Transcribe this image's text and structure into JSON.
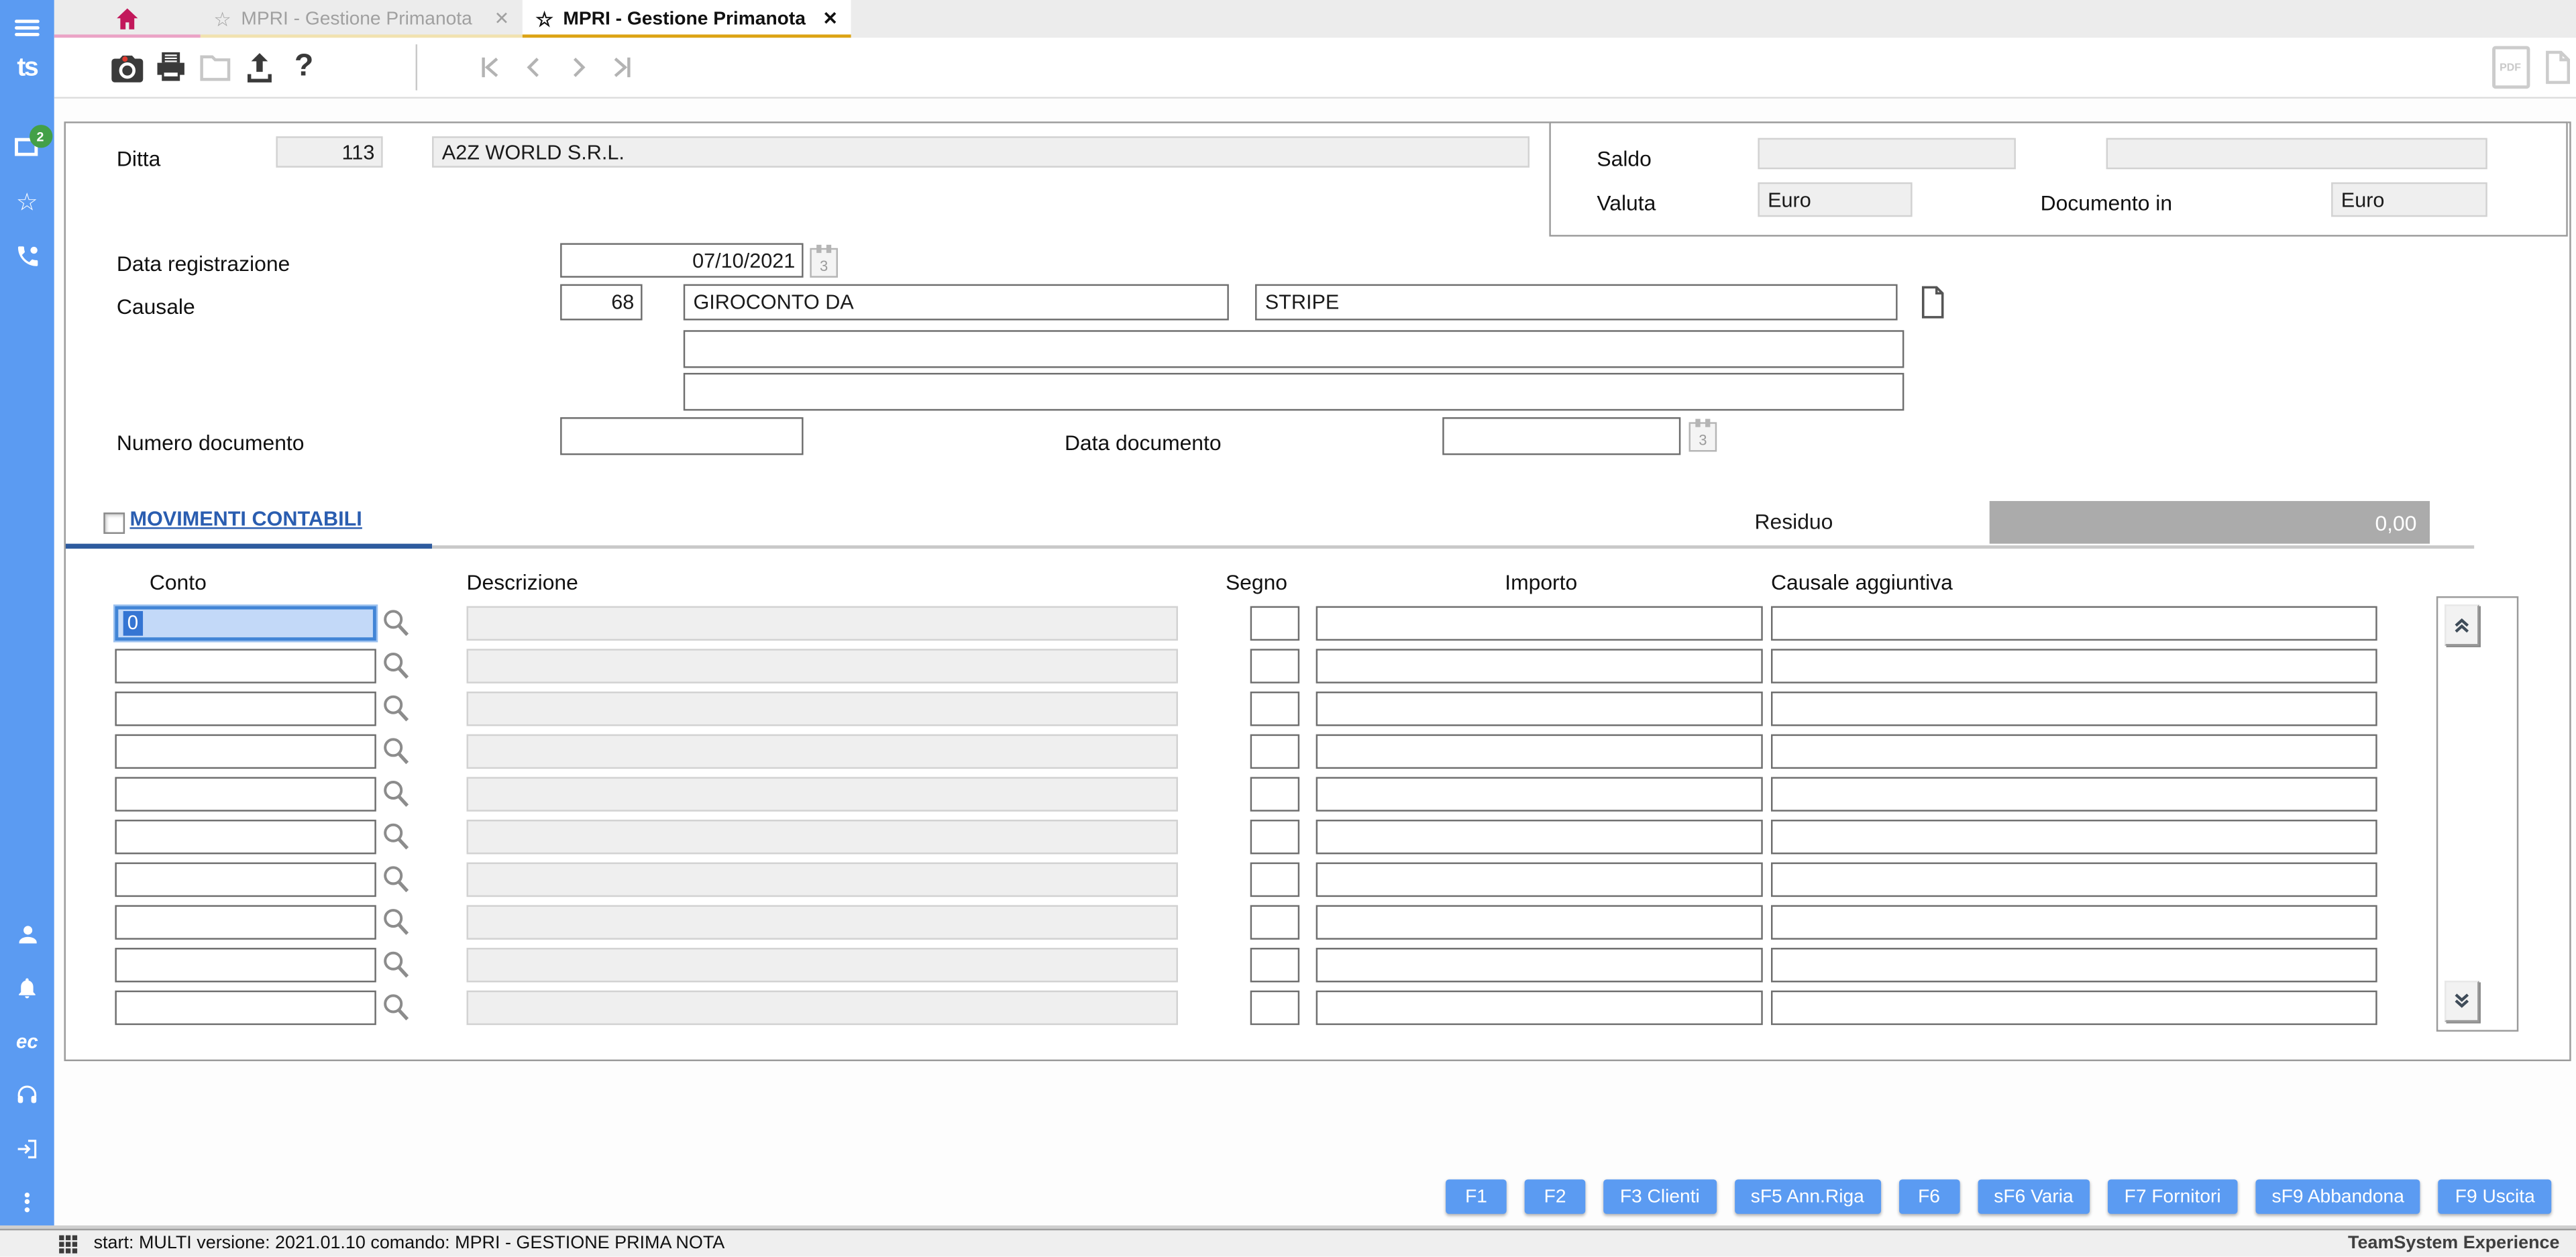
{
  "sidebar": {
    "logo_text": "ts",
    "tabs_badge": "2",
    "ec_label": "ec",
    "color": "#5b9bf2"
  },
  "tabbar": {
    "star_glyph": "☆",
    "close_glyph": "✕",
    "tabs": [
      {
        "label": "MPRI - Gestione Primanota",
        "active": false
      },
      {
        "label": "MPRI - Gestione Primanota",
        "active": true
      }
    ],
    "accent_pink": "#c2185b",
    "accent_gold": "#dca314"
  },
  "toolbar": {
    "help_glyph": "?",
    "pdf_label": "PDF"
  },
  "form": {
    "ditta_label": "Ditta",
    "ditta_code": "113",
    "ditta_name": "A2Z WORLD S.R.L.",
    "saldo_label": "Saldo",
    "saldo_value1": "",
    "saldo_value2": "",
    "valuta_label": "Valuta",
    "valuta_value": "Euro",
    "documento_in_label": "Documento in",
    "documento_in_value": "Euro",
    "data_registrazione_label": "Data registrazione",
    "data_registrazione_value": "07/10/2021",
    "causale_label": "Causale",
    "causale_code": "68",
    "causale_desc": "GIROCONTO DA",
    "causale_desc2": "STRIPE",
    "causale_extra1": "",
    "causale_extra2": "",
    "numero_documento_label": "Numero documento",
    "numero_documento_value": "",
    "data_documento_label": "Data documento",
    "data_documento_value": "",
    "calendar_glyph": "3"
  },
  "movimenti": {
    "title": "MOVIMENTI CONTABILI",
    "residuo_label": "Residuo",
    "residuo_value": "0,00",
    "columns": [
      "Conto",
      "Descrizione",
      "Segno",
      "Importo",
      "Causale aggiuntiva"
    ],
    "rows": [
      {
        "conto": "0",
        "descrizione": "",
        "segno": "",
        "importo": "",
        "causale_aggiuntiva": "",
        "focused": true
      },
      {
        "conto": "",
        "descrizione": "",
        "segno": "",
        "importo": "",
        "causale_aggiuntiva": "",
        "focused": false
      },
      {
        "conto": "",
        "descrizione": "",
        "segno": "",
        "importo": "",
        "causale_aggiuntiva": "",
        "focused": false
      },
      {
        "conto": "",
        "descrizione": "",
        "segno": "",
        "importo": "",
        "causale_aggiuntiva": "",
        "focused": false
      },
      {
        "conto": "",
        "descrizione": "",
        "segno": "",
        "importo": "",
        "causale_aggiuntiva": "",
        "focused": false
      },
      {
        "conto": "",
        "descrizione": "",
        "segno": "",
        "importo": "",
        "causale_aggiuntiva": "",
        "focused": false
      },
      {
        "conto": "",
        "descrizione": "",
        "segno": "",
        "importo": "",
        "causale_aggiuntiva": "",
        "focused": false
      },
      {
        "conto": "",
        "descrizione": "",
        "segno": "",
        "importo": "",
        "causale_aggiuntiva": "",
        "focused": false
      },
      {
        "conto": "",
        "descrizione": "",
        "segno": "",
        "importo": "",
        "causale_aggiuntiva": "",
        "focused": false
      },
      {
        "conto": "",
        "descrizione": "",
        "segno": "",
        "importo": "",
        "causale_aggiuntiva": "",
        "focused": false
      }
    ]
  },
  "function_keys": [
    "F1",
    "F2",
    "F3 Clienti",
    "sF5 Ann.Riga",
    "F6",
    "sF6 Varia",
    "F7 Fornitori",
    "sF9 Abbandona",
    "F9 Uscita"
  ],
  "statusbar": {
    "message": "start: MULTI versione: 2021.01.10 comando: MPRI - GESTIONE PRIMA NOTA",
    "brand": "TeamSystem Experience"
  }
}
